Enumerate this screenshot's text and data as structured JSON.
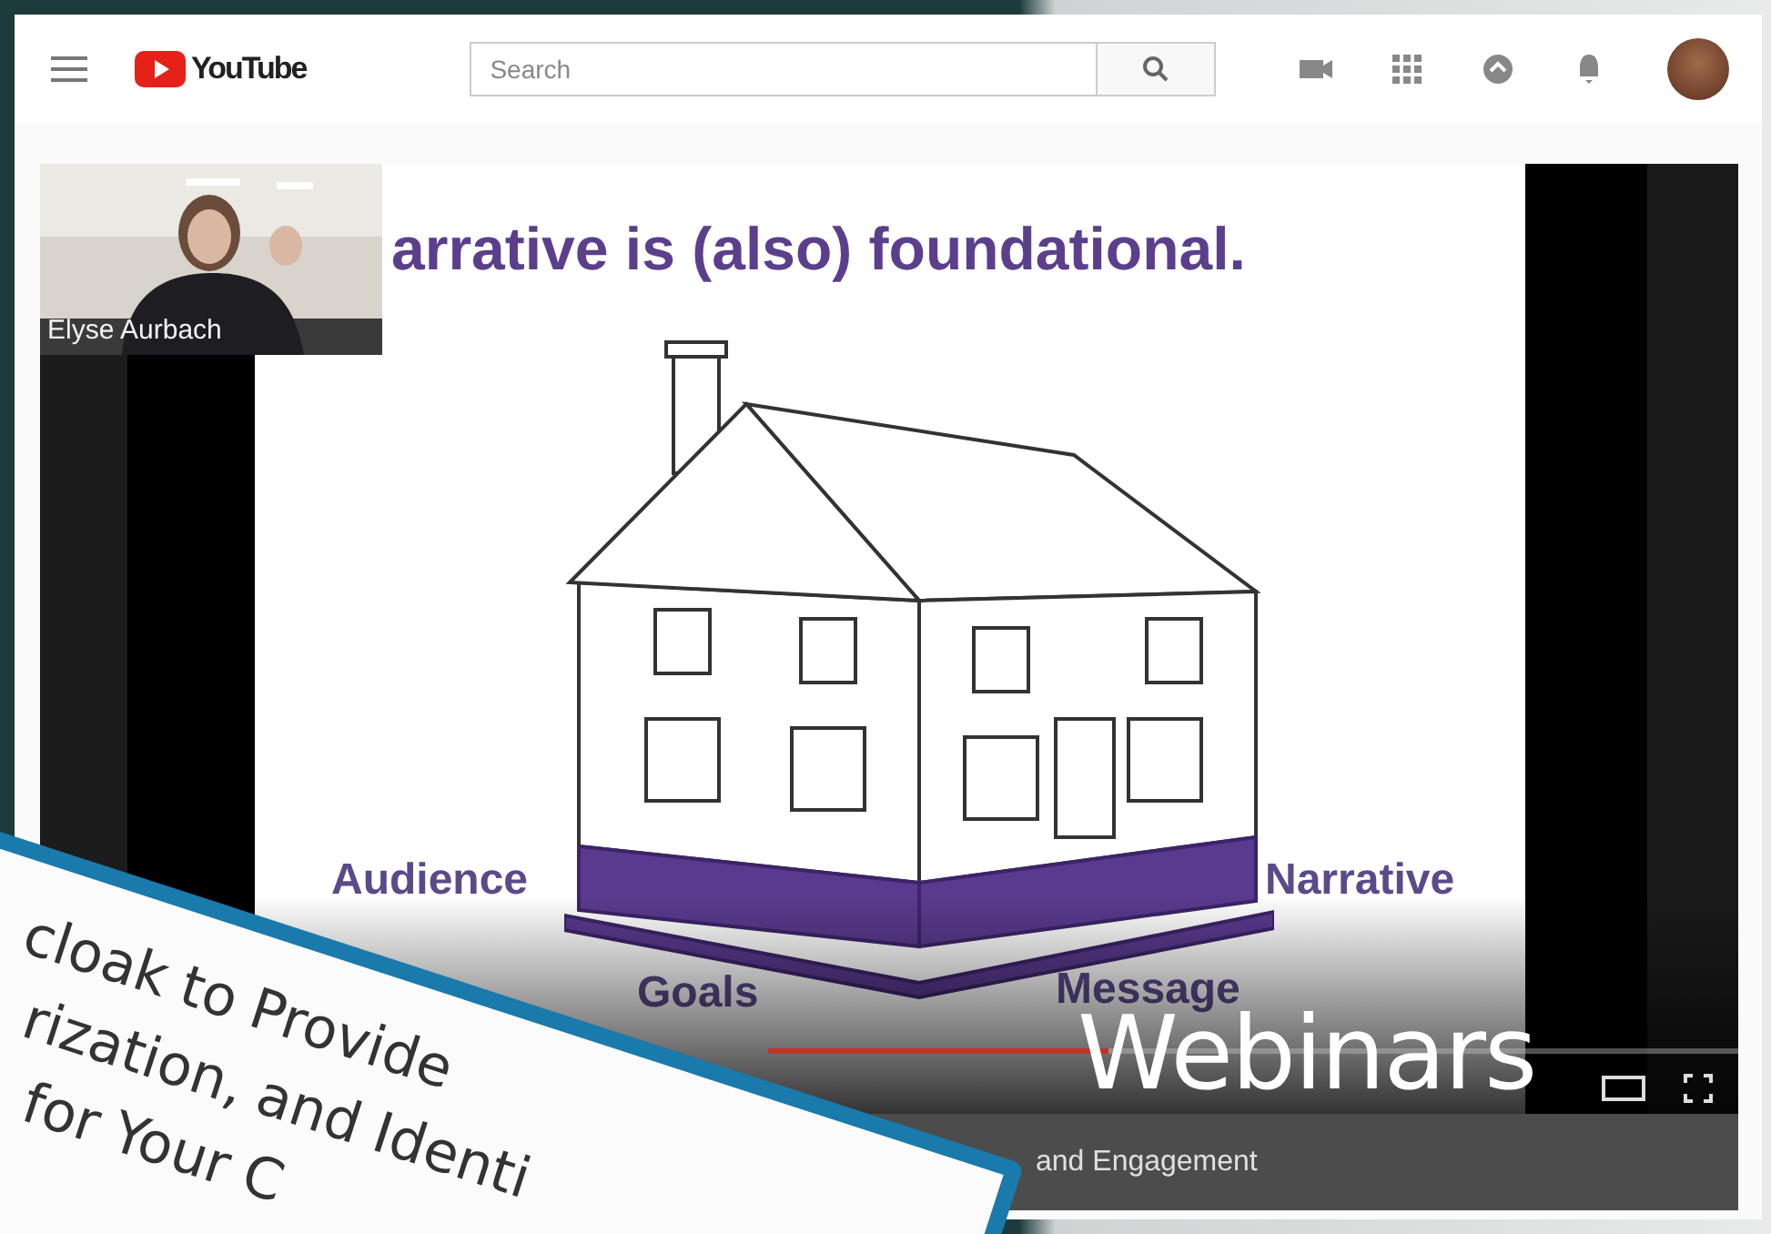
{
  "header": {
    "logo": "YouTube",
    "search": {
      "placeholder": "Search"
    }
  },
  "player": {
    "webcam": {
      "kind": "picture",
      "caption": "Elyse Aurbach"
    },
    "slide": {
      "title": "arrative is (also) foundational.",
      "labels": [
        {
          "text": "Audience"
        },
        {
          "text": "Narrative"
        },
        {
          "text": "Goals"
        },
        {
          "text": "Message"
        }
      ]
    },
    "progress": {
      "level": 0.35
    }
  },
  "video_title": "and Engagement",
  "card": {
    "lines": [
      "cloak to Provide",
      "rization, and Identi",
      "for Your C"
    ]
  },
  "overlay_title": "Webinars"
}
